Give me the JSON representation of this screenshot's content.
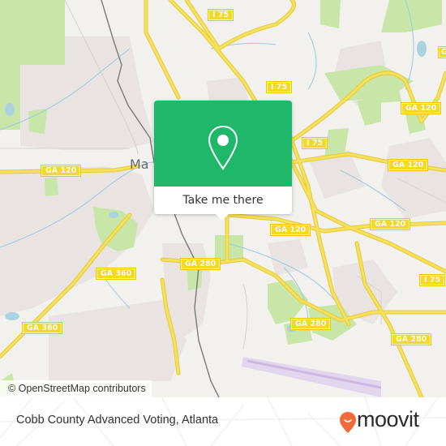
{
  "map": {
    "city_label": "Ma",
    "attribution": "© OpenStreetMap contributors",
    "colors": {
      "land": "#f2f1ed",
      "residential": "#e9e3e1",
      "park": "#c8e6a8",
      "water": "#aad3df",
      "highway": "#f6e15a",
      "highway_outline": "#e6c93a",
      "rail": "#7a7a7a",
      "airport": "#e2d6ee"
    },
    "road_labels": [
      {
        "id": "i75-north",
        "text": "I 75"
      },
      {
        "id": "i75-mid",
        "text": "I 75"
      },
      {
        "id": "i75-east",
        "text": "I 75"
      },
      {
        "id": "i75-southeast",
        "text": "I 75"
      },
      {
        "id": "ga120-west",
        "text": "GA 120"
      },
      {
        "id": "ga120-northeast",
        "text": "GA 120"
      },
      {
        "id": "ga120-east",
        "text": "GA 120"
      },
      {
        "id": "ga120-center",
        "text": "GA 120"
      },
      {
        "id": "ga120-southeast",
        "text": "GA 120"
      },
      {
        "id": "ga360-north",
        "text": "GA 360"
      },
      {
        "id": "ga360-south",
        "text": "GA 360"
      },
      {
        "id": "ga280-west",
        "text": "GA 280"
      },
      {
        "id": "ga280-center",
        "text": "GA 280"
      },
      {
        "id": "ga280-east",
        "text": "GA 280"
      },
      {
        "id": "ga-edge",
        "text": "G"
      }
    ]
  },
  "popup": {
    "icon": "map-pin-icon",
    "cta_label": "Take me there",
    "header_color": "#1fb76a"
  },
  "footer": {
    "place_name": "Cobb County Advanced Voting, Atlanta",
    "brand": {
      "name": "moovit",
      "logo_icon": "moovit-pin-smile-icon",
      "accent_color": "#f26a3a"
    }
  }
}
